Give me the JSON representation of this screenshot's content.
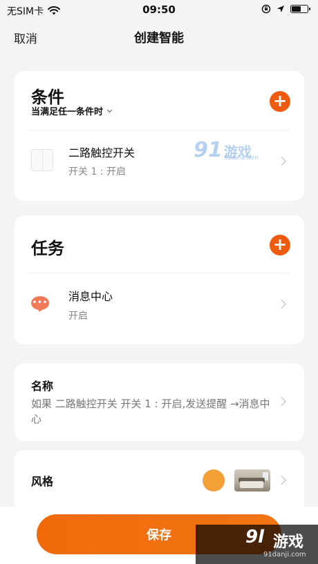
{
  "status_bar": {
    "carrier": "无SIM卡",
    "time": "09:50",
    "battery_level": 0.6
  },
  "nav": {
    "cancel_label": "取消",
    "title": "创建智能"
  },
  "conditions": {
    "heading": "条件",
    "mode_label": "当满足任一条件时",
    "items": [
      {
        "icon": "two-gang-switch-icon",
        "title": "二路触控开关",
        "detail": "开关 1 : 开启"
      }
    ]
  },
  "tasks": {
    "heading": "任务",
    "items": [
      {
        "icon": "message-center-icon",
        "title": "消息中心",
        "detail": "开启"
      }
    ]
  },
  "name": {
    "label": "名称",
    "value": "如果 二路触控开关 开关 1 : 开启,发送提醒 →消息中心"
  },
  "style": {
    "label": "风格",
    "color": "#f2a035"
  },
  "save_label": "保存",
  "colors": {
    "accent": "#ee5b0f",
    "background": "#f4f4f6"
  },
  "watermarks": {
    "top_big": "91",
    "top_cn": "游戏",
    "top_url": "91danji.com",
    "bottom_big": "9l",
    "bottom_cn": "游戏",
    "bottom_url": "91danji.com"
  }
}
